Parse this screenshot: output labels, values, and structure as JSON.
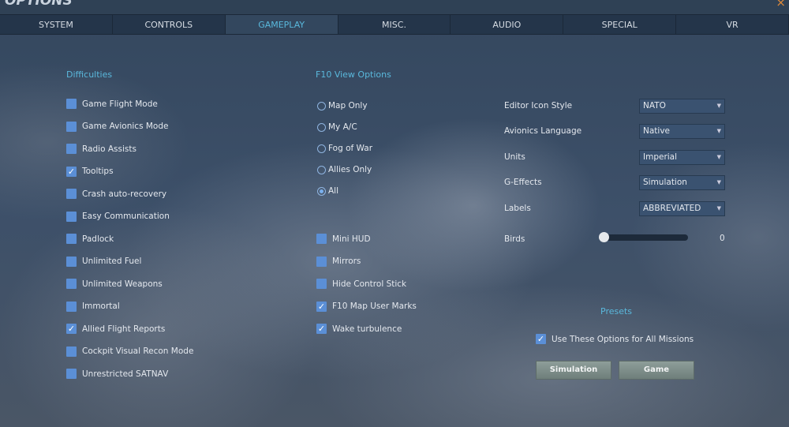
{
  "window": {
    "title": "OPTIONS",
    "close": "×"
  },
  "tabs": [
    "SYSTEM",
    "CONTROLS",
    "GAMEPLAY",
    "MISC.",
    "AUDIO",
    "SPECIAL",
    "VR"
  ],
  "active_tab": "GAMEPLAY",
  "difficulties": {
    "heading": "Difficulties",
    "items": [
      {
        "label": "Game Flight Mode",
        "checked": false
      },
      {
        "label": "Game Avionics Mode",
        "checked": false
      },
      {
        "label": "Radio Assists",
        "checked": false
      },
      {
        "label": "Tooltips",
        "checked": true
      },
      {
        "label": "Crash auto-recovery",
        "checked": false
      },
      {
        "label": "Easy Communication",
        "checked": false
      },
      {
        "label": "Padlock",
        "checked": false
      },
      {
        "label": "Unlimited Fuel",
        "checked": false
      },
      {
        "label": "Unlimited Weapons",
        "checked": false
      },
      {
        "label": "Immortal",
        "checked": false
      },
      {
        "label": "Allied Flight Reports",
        "checked": true
      },
      {
        "label": "Cockpit Visual Recon Mode",
        "checked": false
      },
      {
        "label": "Unrestricted SATNAV",
        "checked": false
      }
    ]
  },
  "f10": {
    "heading": "F10 View Options",
    "options": [
      {
        "label": "Map Only",
        "selected": false
      },
      {
        "label": "My A/C",
        "selected": false
      },
      {
        "label": "Fog of War",
        "selected": false
      },
      {
        "label": "Allies Only",
        "selected": false
      },
      {
        "label": "All",
        "selected": true
      }
    ]
  },
  "misc_checks": [
    {
      "label": "Mini HUD",
      "checked": false
    },
    {
      "label": "Mirrors",
      "checked": false
    },
    {
      "label": "Hide Control Stick",
      "checked": false
    },
    {
      "label": "F10 Map User Marks",
      "checked": true
    },
    {
      "label": "Wake turbulence",
      "checked": true
    }
  ],
  "settings": [
    {
      "label": "Editor Icon Style",
      "value": "NATO"
    },
    {
      "label": "Avionics Language",
      "value": "Native"
    },
    {
      "label": "Units",
      "value": "Imperial"
    },
    {
      "label": "G-Effects",
      "value": "Simulation"
    },
    {
      "label": "Labels",
      "value": "ABBREVIATED"
    }
  ],
  "birds": {
    "label": "Birds",
    "value": "0",
    "fraction": 0
  },
  "presets": {
    "heading": "Presets",
    "use_all": {
      "label": "Use These Options for All Missions",
      "checked": true
    },
    "buttons": [
      "Simulation",
      "Game"
    ]
  },
  "check_glyph": "✓",
  "arrow_glyph": "▼"
}
